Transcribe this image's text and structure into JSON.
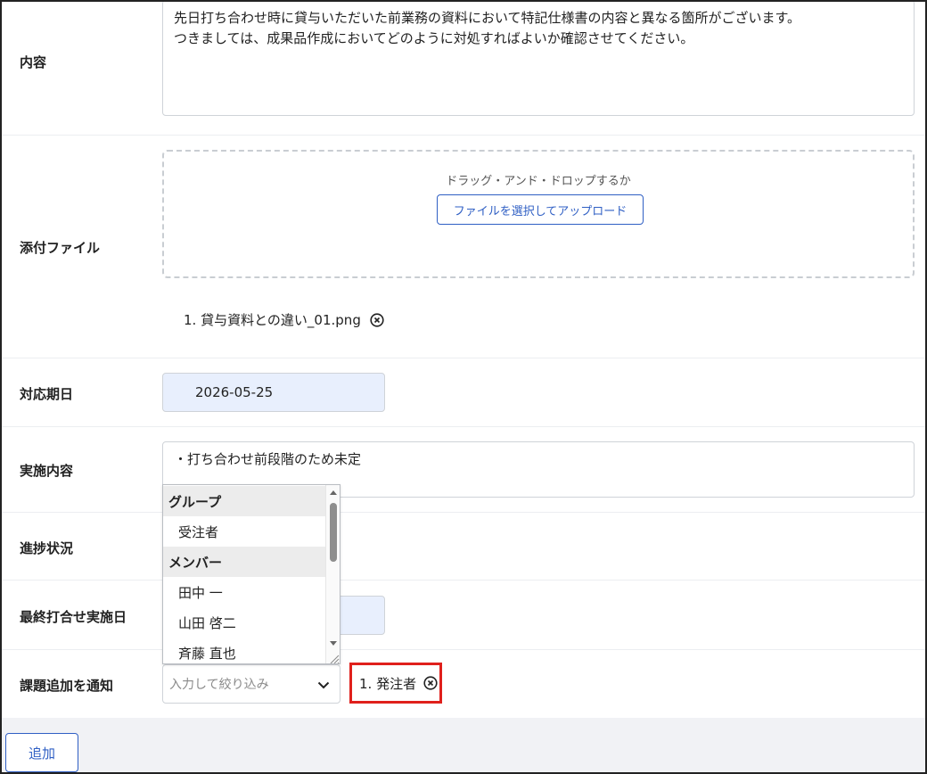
{
  "fields": {
    "content": {
      "label": "内容",
      "line1": "先日打ち合わせ時に貸与いただいた前業務の資料において特記仕様書の内容と異なる箇所がございます。",
      "line2": "つきましては、成果品作成においてどのように対処すればよいか確認させてください。"
    },
    "attachment": {
      "label": "添付ファイル",
      "drop_hint": "ドラッグ・アンド・ドロップするか",
      "upload_button": "ファイルを選択してアップロード",
      "files": [
        "1. 貸与資料との違い_01.png"
      ]
    },
    "due_date": {
      "label": "対応期日",
      "value": "2026-05-25"
    },
    "action": {
      "label": "実施内容",
      "value": "・打ち合わせ前段階のため未定"
    },
    "progress": {
      "label": "進捗状況"
    },
    "last_meeting_date": {
      "label": "最終打合せ実施日"
    },
    "notify": {
      "label": "課題追加を通知",
      "placeholder": "入力して絞り込み",
      "selected": [
        "1. 発注者"
      ]
    }
  },
  "dropdown": {
    "group_header_1": "グループ",
    "group_1_options": [
      "受注者"
    ],
    "group_header_2": "メンバー",
    "group_2_options": [
      "田中 一",
      "山田 啓二",
      "斉藤 直也"
    ]
  },
  "footer": {
    "add_button": "追加"
  },
  "colors": {
    "accent": "#2f5fc4",
    "highlight_border": "#e0201c",
    "date_bg": "#e8effd",
    "footer_bg": "#f1f2f5"
  }
}
